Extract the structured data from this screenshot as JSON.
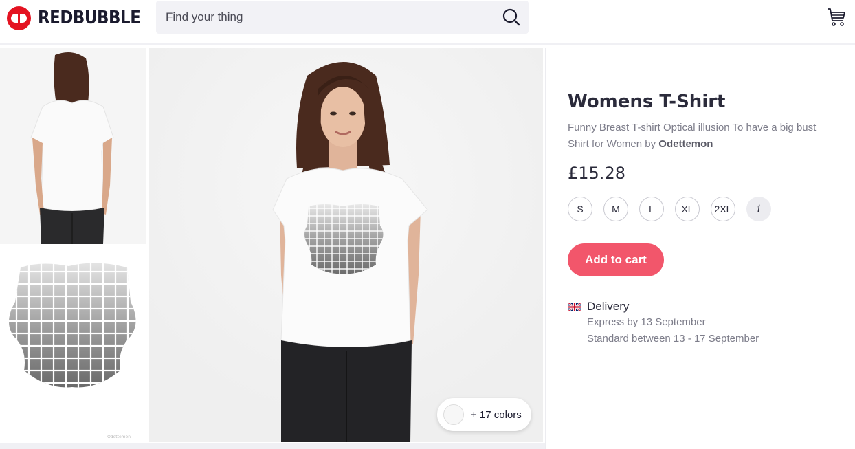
{
  "header": {
    "logo_text": "REDBUBBLE",
    "search_placeholder": "Find your thing"
  },
  "gallery": {
    "colors_label": "+ 17 colors",
    "watermark": "Odettemon"
  },
  "product": {
    "title": "Womens T-Shirt",
    "description": "Funny Breast T-shirt Optical illusion To have a big bust Shirt for Women by ",
    "artist": "Odettemon",
    "price": "£15.28",
    "sizes": [
      "S",
      "M",
      "L",
      "XL",
      "2XL"
    ],
    "size_info": "i",
    "add_to_cart": "Add to cart"
  },
  "delivery": {
    "title": "Delivery",
    "express": "Express by 13 September",
    "standard": "Standard between 13 - 17 September"
  },
  "colors": {
    "brand": "#e41321",
    "accent": "#f2566b"
  }
}
